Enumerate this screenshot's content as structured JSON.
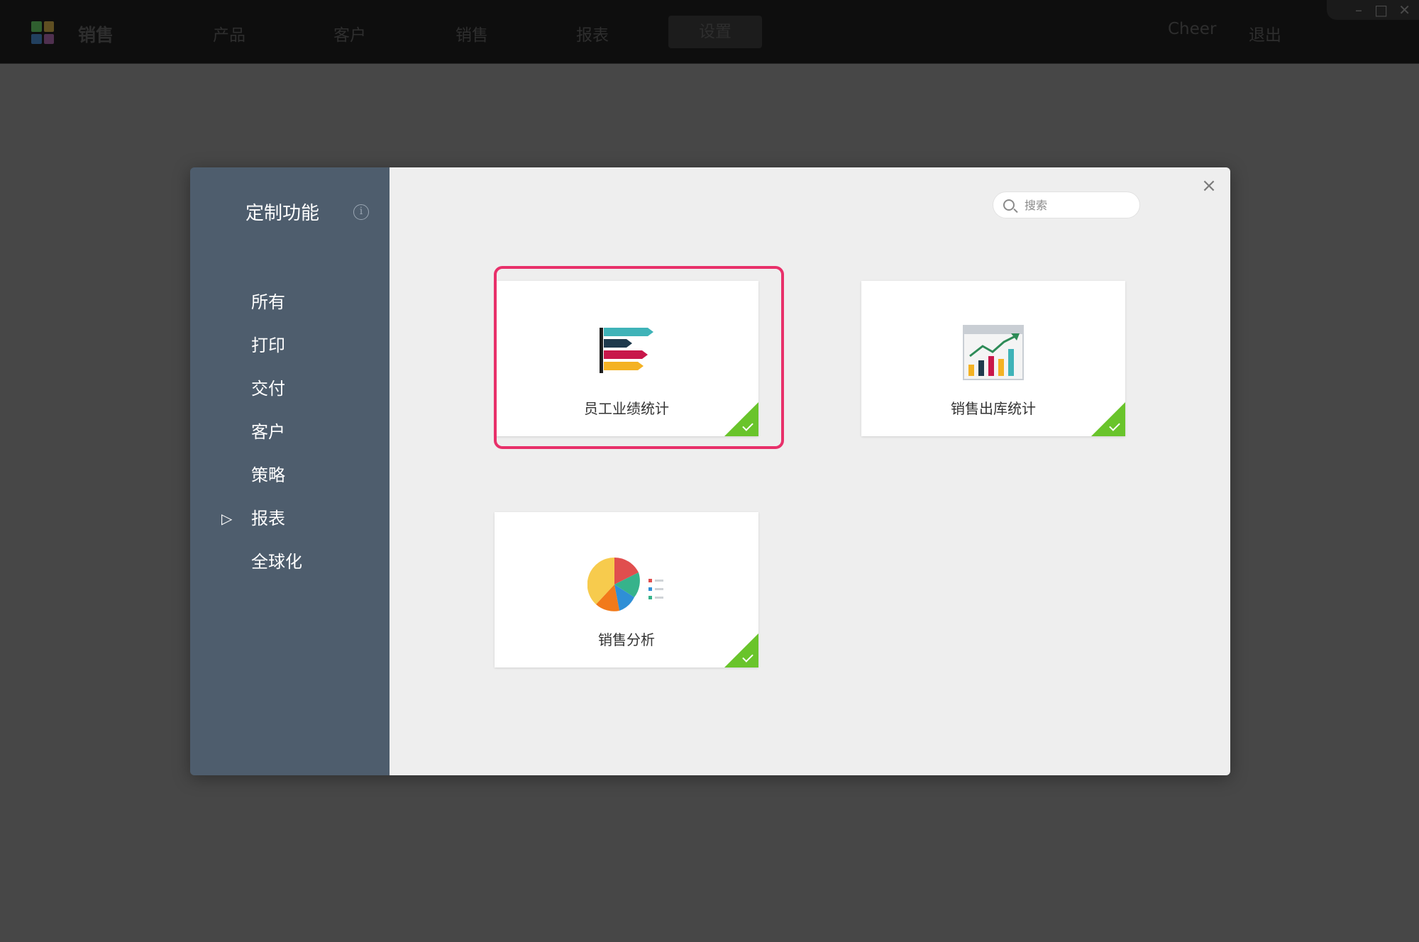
{
  "app": {
    "name": "销售",
    "logo_colors": [
      "#3b7a3b",
      "#6b5a2a",
      "#2a4a6b",
      "#5a3a5a"
    ]
  },
  "nav": {
    "items": [
      {
        "label": "产品"
      },
      {
        "label": "客户"
      },
      {
        "label": "销售"
      },
      {
        "label": "报表"
      },
      {
        "label": "设置",
        "active": true
      }
    ],
    "user": "Cheer",
    "logout": "退出"
  },
  "window_controls": {
    "minimize": "–",
    "maximize": "□",
    "close": "✕"
  },
  "modal": {
    "sidebar": {
      "title": "定制功能",
      "info_icon": "i",
      "items": [
        {
          "label": "所有"
        },
        {
          "label": "打印"
        },
        {
          "label": "交付"
        },
        {
          "label": "客户"
        },
        {
          "label": "策略"
        },
        {
          "label": "报表",
          "selected": true,
          "marker": "▷"
        },
        {
          "label": "全球化"
        }
      ]
    },
    "close_label": "×",
    "search": {
      "placeholder": "搜索",
      "value": ""
    },
    "cards": [
      {
        "label": "员工业绩统计",
        "icon": "horizontal-bar-chart-icon",
        "checked": true,
        "highlighted": true
      },
      {
        "label": "销售出库统计",
        "icon": "trend-bar-chart-icon",
        "checked": true,
        "highlighted": false
      },
      {
        "label": "销售分析",
        "icon": "pie-chart-icon",
        "checked": true,
        "highlighted": false
      }
    ]
  },
  "colors": {
    "sidebar_bg": "#4e5d6d",
    "content_bg": "#eeeeee",
    "check_green": "#69c42b",
    "highlight": "#e8306a"
  }
}
